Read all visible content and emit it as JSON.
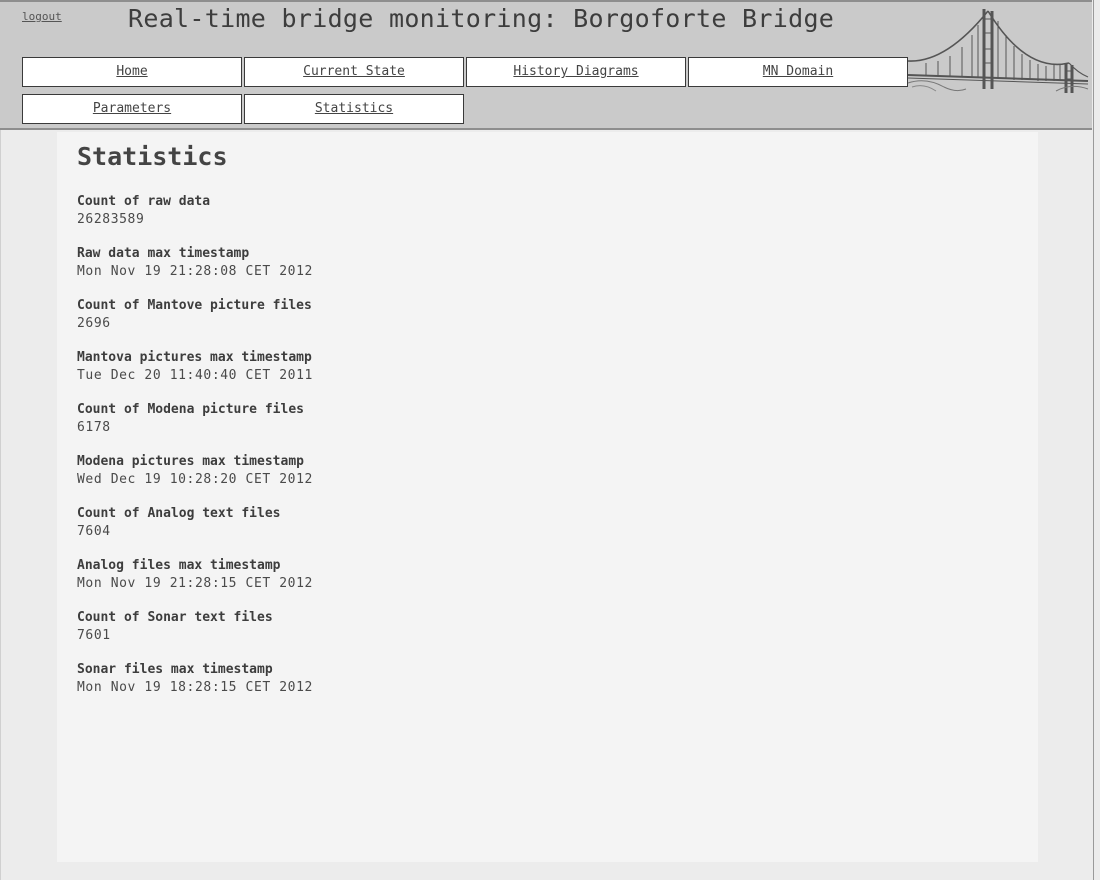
{
  "header": {
    "logout_label": "logout",
    "site_title": "Real-time bridge monitoring: Borgoforte Bridge"
  },
  "nav": {
    "items": [
      {
        "label": "Home"
      },
      {
        "label": "Current State"
      },
      {
        "label": "History Diagrams"
      },
      {
        "label": "MN Domain"
      },
      {
        "label": "Parameters"
      },
      {
        "label": "Statistics"
      }
    ]
  },
  "page": {
    "heading": "Statistics"
  },
  "stats": [
    {
      "label": "Count of raw data",
      "value": "26283589"
    },
    {
      "label": "Raw data max timestamp",
      "value": "Mon Nov 19 21:28:08 CET 2012"
    },
    {
      "label": "Count of Mantove picture files",
      "value": "2696"
    },
    {
      "label": "Mantova pictures max timestamp",
      "value": "Tue Dec 20 11:40:40 CET 2011"
    },
    {
      "label": "Count of Modena picture files",
      "value": "6178"
    },
    {
      "label": "Modena pictures max timestamp",
      "value": "Wed Dec 19 10:28:20 CET 2012"
    },
    {
      "label": "Count of Analog text files",
      "value": "7604"
    },
    {
      "label": "Analog files max timestamp",
      "value": "Mon Nov 19 21:28:15 CET 2012"
    },
    {
      "label": "Count of Sonar text files",
      "value": "7601"
    },
    {
      "label": "Sonar files max timestamp",
      "value": "Mon Nov 19 18:28:15 CET 2012"
    }
  ],
  "colors": {
    "header_bg": "#cacaca",
    "page_bg": "#ececec",
    "content_bg": "#f4f4f4",
    "nav_button_bg": "#ffffff",
    "text": "#3d3d3d"
  },
  "icons": {
    "logo": "suspension-bridge-logo"
  }
}
